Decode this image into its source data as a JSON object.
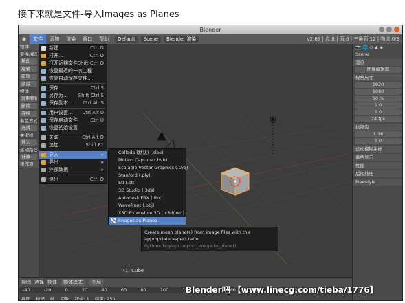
{
  "caption": "接下来就是文件-导入Images as Planes",
  "window": {
    "title": "Blender"
  },
  "infobar": {
    "menus": [
      "文件",
      "添加",
      "渲染",
      "窗口",
      "帮助"
    ],
    "layout": "Default",
    "scene": "Scene",
    "engine": "Blender 渲染",
    "stats": "v2.69 | 点:8 | 面:6 | 三角面:12 | 物体:0/3"
  },
  "leftpanel": {
    "header": "物体",
    "items": [
      "变换/编辑",
      "移动",
      "旋转",
      "缩放",
      "原点",
      "物体",
      "复制物体",
      "删除",
      "连接",
      "着色方式",
      "光滑",
      "关键帧",
      "插入",
      "运动路径",
      "计算",
      "操作项"
    ]
  },
  "file_menu": [
    {
      "label": "新建",
      "shortcut": "Ctrl N",
      "color": "#e0e0e0"
    },
    {
      "label": "打开...",
      "shortcut": "Ctrl O",
      "color": "#d9a441"
    },
    {
      "label": "打开近期文件",
      "shortcut": "Shift Ctrl O",
      "color": "#d9a441"
    },
    {
      "label": "恢复最近的一次工程",
      "shortcut": "",
      "color": "#9ab0cc"
    },
    {
      "label": "恢复自动保存文件...",
      "shortcut": "",
      "color": "#9ab0cc"
    },
    {
      "label": "保存",
      "shortcut": "Ctrl S",
      "color": "#9ab0cc"
    },
    {
      "label": "另存为...",
      "shortcut": "Shift Ctrl S",
      "color": "#9ab0cc"
    },
    {
      "label": "保存副本...",
      "shortcut": "Ctrl Alt S",
      "color": "#9ab0cc"
    },
    {
      "label": "用户设置...",
      "shortcut": "Ctrl Alt U",
      "color": "#9ab0cc"
    },
    {
      "label": "保存启动文件",
      "shortcut": "Ctrl U",
      "color": "#9ab0cc"
    },
    {
      "label": "恢复初始设置",
      "shortcut": "",
      "color": "#9ab0cc"
    },
    {
      "label": "关联",
      "shortcut": "Ctrl Alt O",
      "color": "#aaaaaa"
    },
    {
      "label": "追加",
      "shortcut": "Shift F1",
      "color": "#aaaaaa"
    },
    {
      "label": "导入",
      "shortcut": "",
      "color": "#d9a441"
    },
    {
      "label": "导出",
      "shortcut": "",
      "color": "#d9a441"
    },
    {
      "label": "外部数据",
      "shortcut": "",
      "color": "#aaaaaa"
    },
    {
      "label": "退出",
      "shortcut": "Ctrl Q",
      "color": "#aaaaaa"
    }
  ],
  "import_submenu": [
    "Collada (默认) (.dae)",
    "Motion Capture (.bvh)",
    "Scalable Vector Graphics (.svg)",
    "Stanford (.ply)",
    "Stl (.stl)",
    "3D Studio (.3ds)",
    "Autodesk FBX (.fbx)",
    "Wavefront (.obj)",
    "X3D Extensible 3D (.x3d/.wrl)",
    "Images as Planes"
  ],
  "tooltip": {
    "text": "Create mesh plane(s) from image files with the appropriate aspect ratio",
    "python": "Python: bpy.ops.import_image.to_plane()"
  },
  "viewport": {
    "label": "(1) Cube",
    "corner": "视)"
  },
  "rightpanel": {
    "scene": "Scene",
    "sections": [
      "渲染",
      "规格尺寸",
      "抗锯齿",
      "运动模糊采样",
      "着色显示",
      "性能",
      "后期处理",
      "Freestyle"
    ],
    "display": "图像编辑器",
    "res_x": "1920",
    "res_y": "1080",
    "percent": "50 %",
    "frame_rate": "24 fps",
    "aspect_x": "1.0",
    "aspect_y": "1.0",
    "aa_samples": "1.16",
    "aa_filter": "1.0"
  },
  "bottombar": {
    "items": [
      "视图",
      "选择",
      "物体",
      "物体模式",
      "全局"
    ]
  },
  "timeline": {
    "ruler": [
      "-40",
      "-20",
      "0",
      "20",
      "40",
      "60",
      "80",
      "100",
      "120",
      "140",
      "160",
      "180",
      "200",
      "220",
      "240",
      "260"
    ],
    "controls": [
      "视图",
      "标记",
      "帧",
      "回放"
    ],
    "start_label": "起始: 1",
    "end_label": "结束: 250"
  },
  "watermark": "Blender吧 【www.linecg.com/tieba/1776】"
}
